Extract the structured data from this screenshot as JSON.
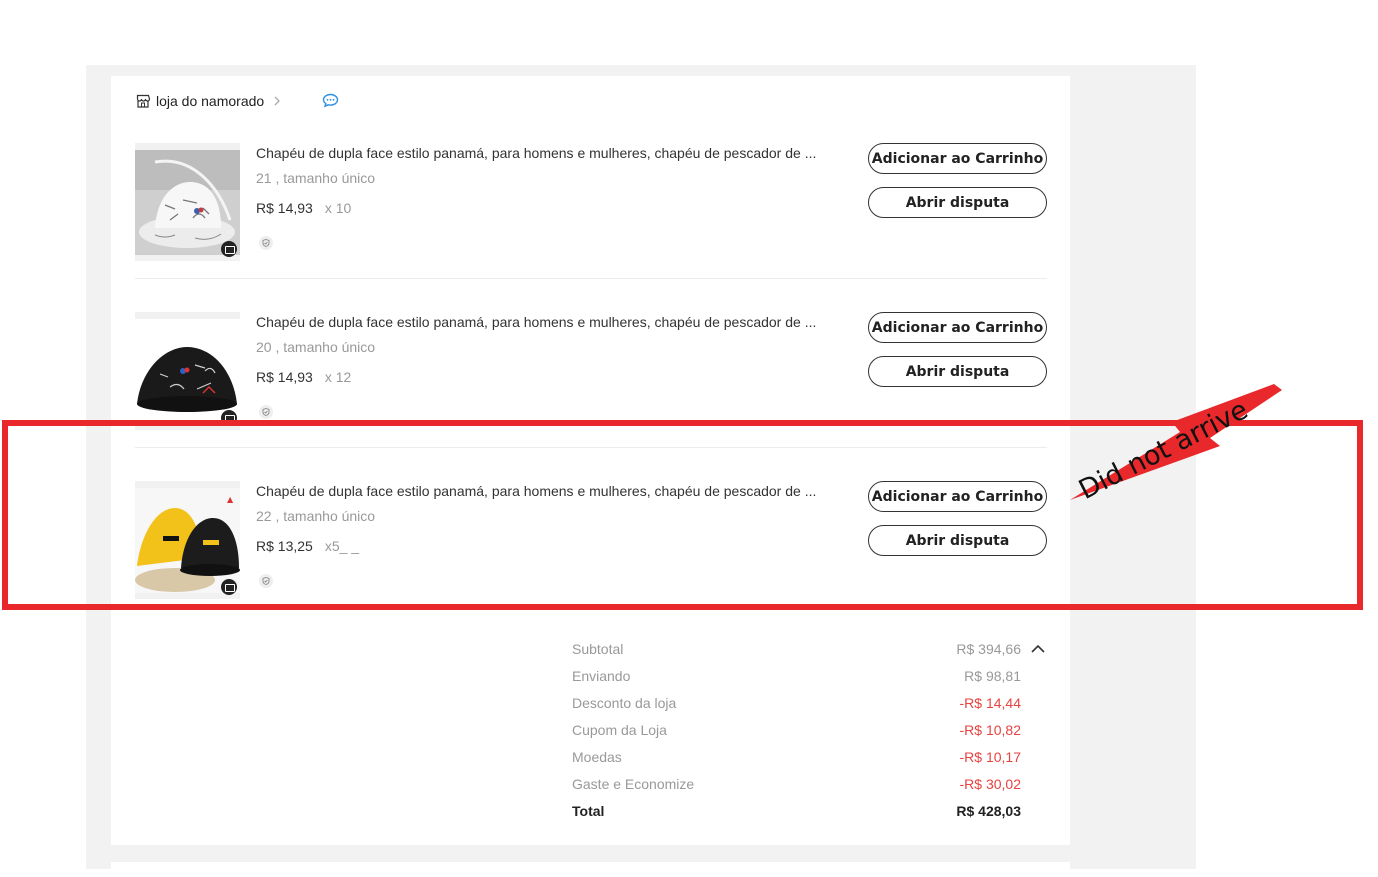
{
  "store": {
    "name": "loja do namorado"
  },
  "items": [
    {
      "title": "Chapéu de dupla face estilo panamá, para homens e mulheres, chapéu de pescador de ...",
      "variant": "21 , tamanho único",
      "price": "R$ 14,93",
      "qty": "x 10",
      "cart_label": "Adicionar ao Carrinho",
      "dispute_label": "Abrir disputa"
    },
    {
      "title": "Chapéu de dupla face estilo panamá, para homens e mulheres, chapéu de pescador de ...",
      "variant": "20 , tamanho único",
      "price": "R$ 14,93",
      "qty": "x 12",
      "cart_label": "Adicionar ao Carrinho",
      "dispute_label": "Abrir disputa"
    },
    {
      "title": "Chapéu de dupla face estilo panamá, para homens e mulheres, chapéu de pescador de ...",
      "variant": "22 , tamanho único",
      "price": "R$ 13,25",
      "qty": "x5_ _",
      "cart_label": "Adicionar ao Carrinho",
      "dispute_label": "Abrir disputa"
    }
  ],
  "summary": [
    {
      "label": "Subtotal",
      "value": "R$ 394,66"
    },
    {
      "label": "Enviando",
      "value": "R$ 98,81"
    },
    {
      "label": "Desconto da loja",
      "value": "-R$ 14,44"
    },
    {
      "label": "Cupom da Loja",
      "value": "-R$ 10,82"
    },
    {
      "label": "Moedas",
      "value": "-R$ 10,17"
    },
    {
      "label": "Gaste e Economize",
      "value": "-R$ 30,02"
    },
    {
      "label": "Total",
      "value": "R$ 428,03"
    }
  ],
  "annotation": {
    "text": "Did not arrive"
  },
  "colors": {
    "highlight": "#e8282b",
    "discount": "#e64340",
    "chat": "#2f8fe6"
  },
  "icons": [
    "store-icon",
    "chevron-right-icon",
    "chat-icon",
    "camera-icon",
    "shield-icon",
    "chevron-up-icon",
    "arrow-icon"
  ]
}
